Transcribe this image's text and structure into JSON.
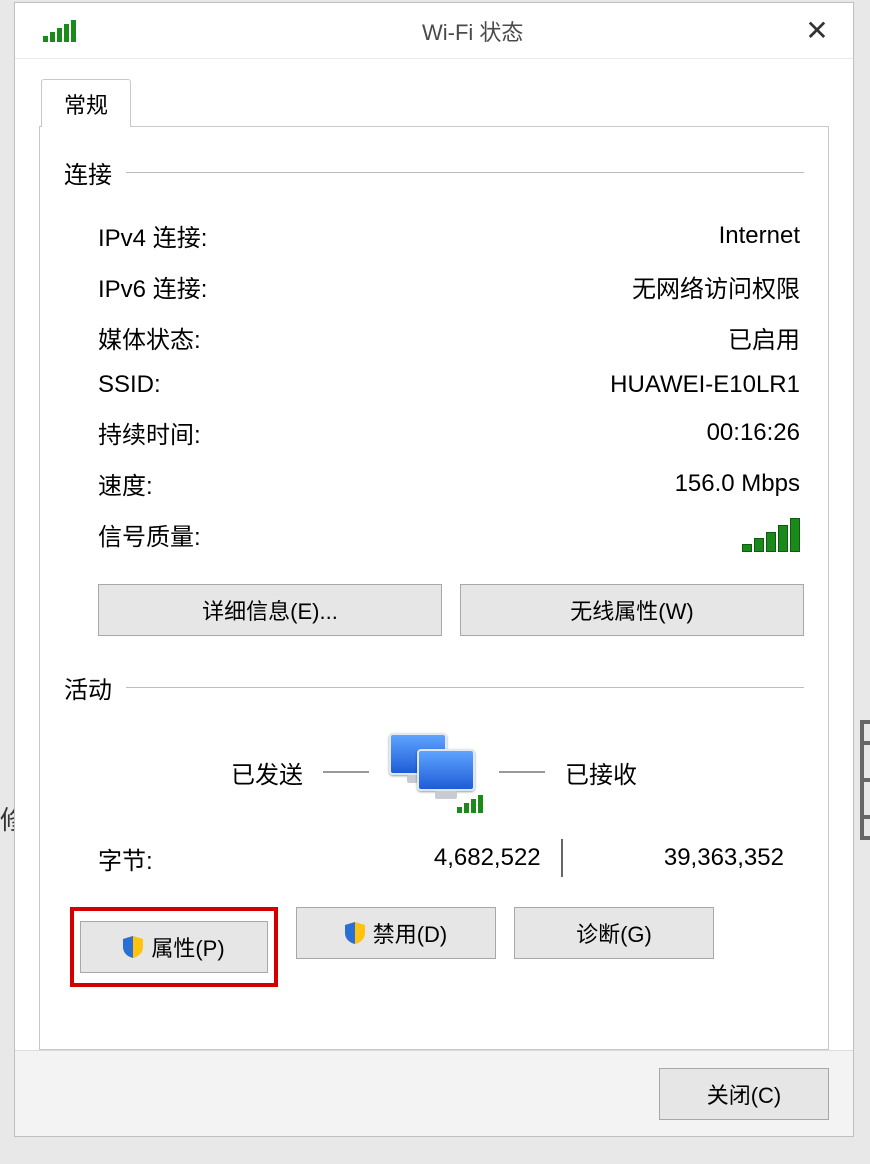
{
  "window": {
    "title": "Wi-Fi 状态"
  },
  "tabs": {
    "general": "常规"
  },
  "connection": {
    "heading": "连接",
    "rows": {
      "ipv4_label": "IPv4 连接:",
      "ipv4_value": "Internet",
      "ipv6_label": "IPv6 连接:",
      "ipv6_value": "无网络访问权限",
      "media_label": "媒体状态:",
      "media_value": "已启用",
      "ssid_label": "SSID:",
      "ssid_value": "HUAWEI-E10LR1",
      "duration_label": "持续时间:",
      "duration_value": "00:16:26",
      "speed_label": "速度:",
      "speed_value": "156.0 Mbps",
      "signal_label": "信号质量:"
    },
    "buttons": {
      "details": "详细信息(E)...",
      "wireless": "无线属性(W)"
    }
  },
  "activity": {
    "heading": "活动",
    "sent_label": "已发送",
    "recv_label": "已接收",
    "bytes_label": "字节:",
    "sent_value": "4,682,522",
    "recv_value": "39,363,352",
    "buttons": {
      "properties": "属性(P)",
      "disable": "禁用(D)",
      "diagnose": "诊断(G)"
    }
  },
  "footer": {
    "close": "关闭(C)"
  }
}
